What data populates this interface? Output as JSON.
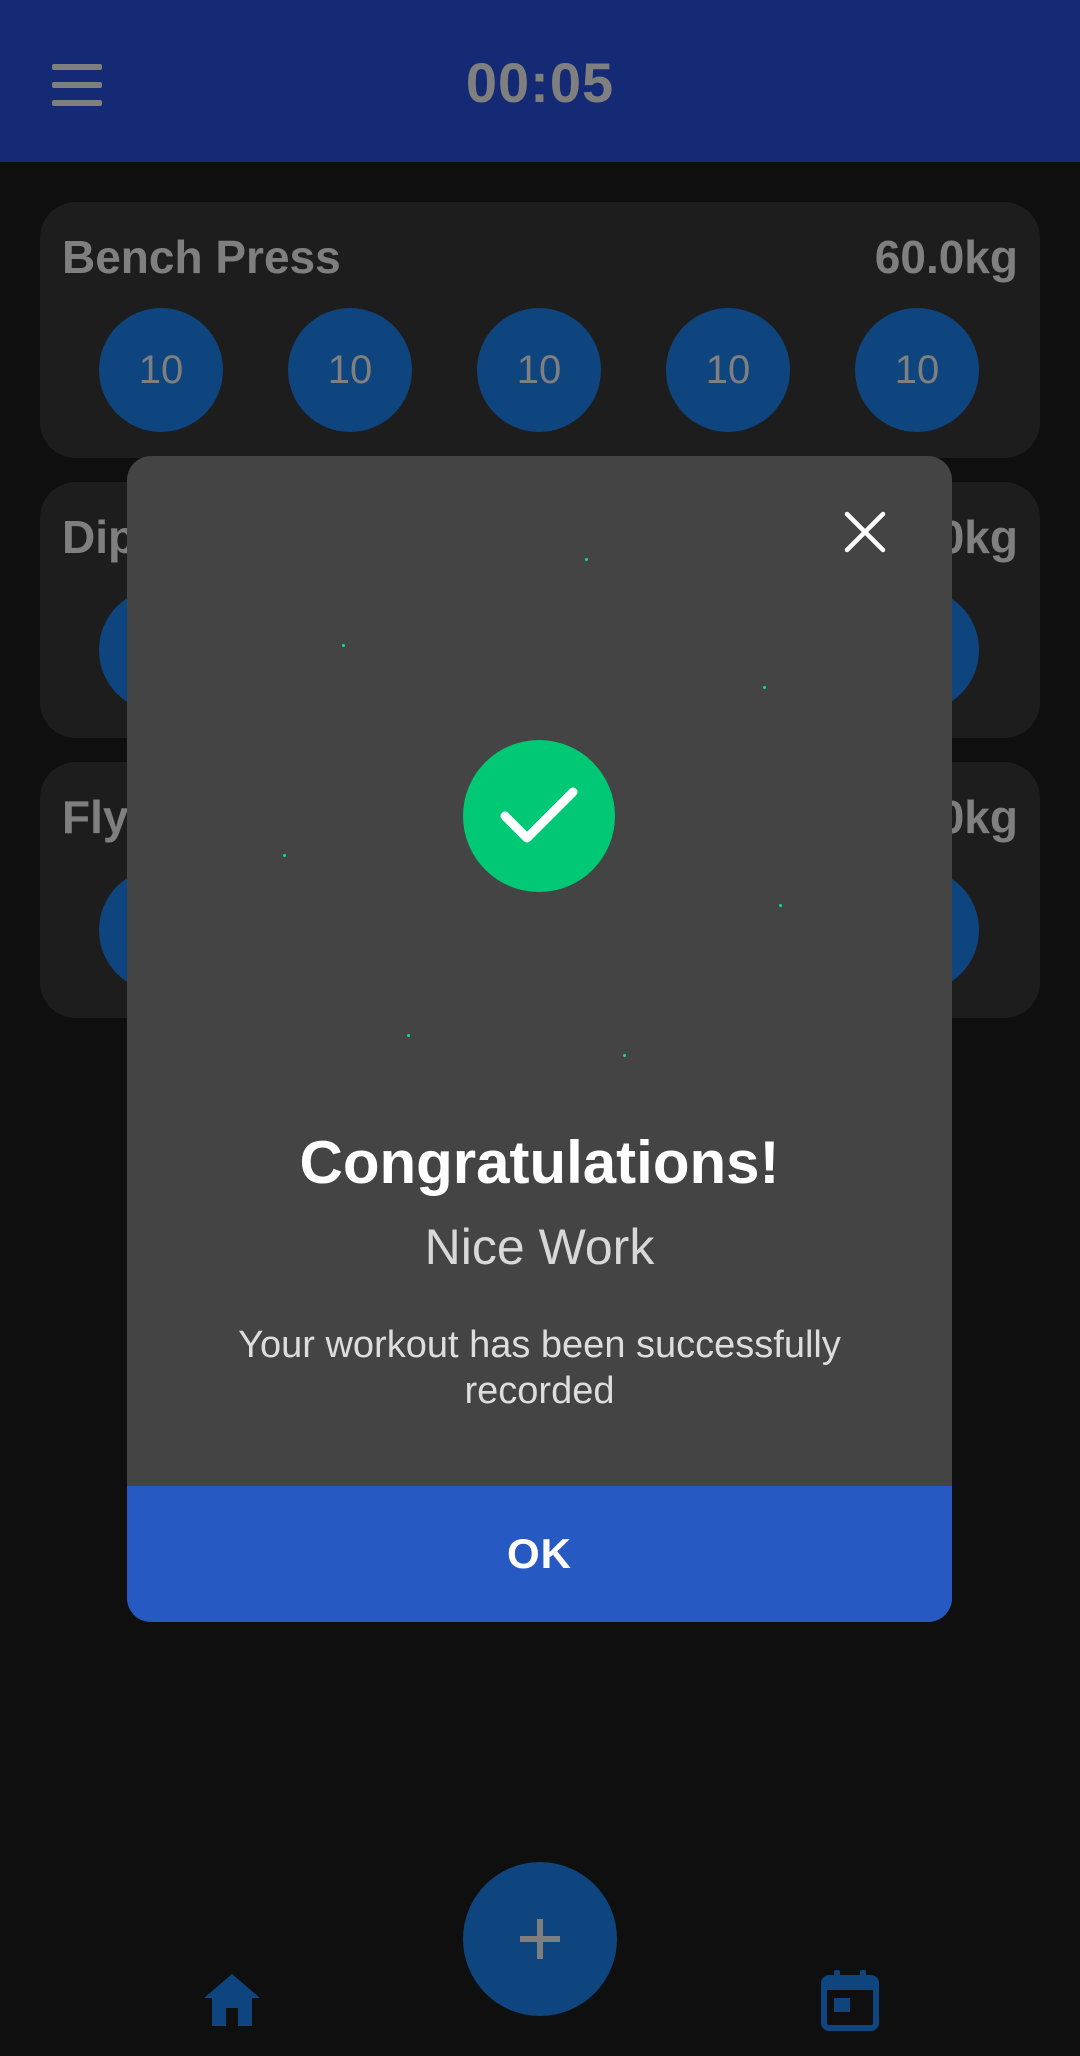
{
  "app_bar": {
    "timer": "00:05",
    "menu_icon": "hamburger-menu-icon"
  },
  "exercises": [
    {
      "name": "Bench Press",
      "weight": "60.0kg",
      "reps": [
        "10",
        "10",
        "10",
        "10",
        "10"
      ]
    },
    {
      "name": "Dips",
      "weight": "0.0kg",
      "reps": [
        "",
        "",
        "",
        "",
        ""
      ]
    },
    {
      "name": "Flys",
      "weight": "0.0kg",
      "reps": [
        "",
        "",
        "",
        "",
        ""
      ]
    }
  ],
  "dialog": {
    "title": "Congratulations!",
    "subtitle": "Nice Work",
    "message": "Your workout has been successfully recorded",
    "ok_label": "OK",
    "close_icon": "close-icon",
    "success_icon": "checkmark-icon"
  },
  "bottom_nav": {
    "fab_icon": "plus-icon",
    "home_icon": "home-icon",
    "calendar_icon": "calendar-icon"
  },
  "colors": {
    "app_bar": "#2b55e8",
    "rep_circle": "#1d8bff",
    "success": "#00c875",
    "ok_button": "#2659c2",
    "dialog_bg": "#444444"
  }
}
